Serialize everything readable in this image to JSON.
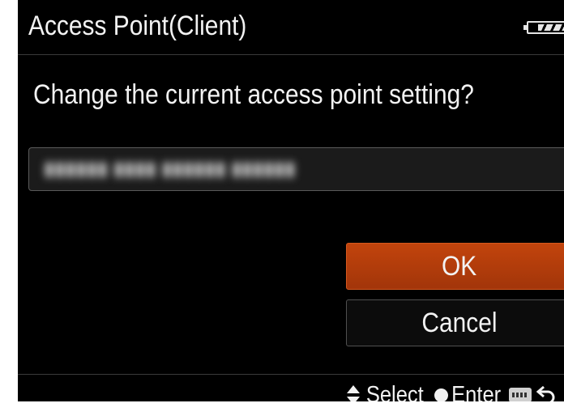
{
  "header": {
    "title": "Access Point(Client)",
    "battery_icon": "battery-icon"
  },
  "dialog": {
    "prompt": "Change the current access point setting?",
    "access_point_value": "▮▮▮▮▮▮ ▮▮▮▮ ▮▮▮▮▮▮ ▮▮▮▮▮▮",
    "ok_label": "OK",
    "cancel_label": "Cancel"
  },
  "guide": {
    "select_label": "Select",
    "enter_label": "Enter",
    "icons": [
      "up-down-arrows-icon",
      "center-button-icon",
      "menu-button-icon",
      "back-arrow-icon"
    ]
  },
  "colors": {
    "background": "#000000",
    "ok_highlight": "#b33d0b",
    "text": "#f2f2f2"
  }
}
